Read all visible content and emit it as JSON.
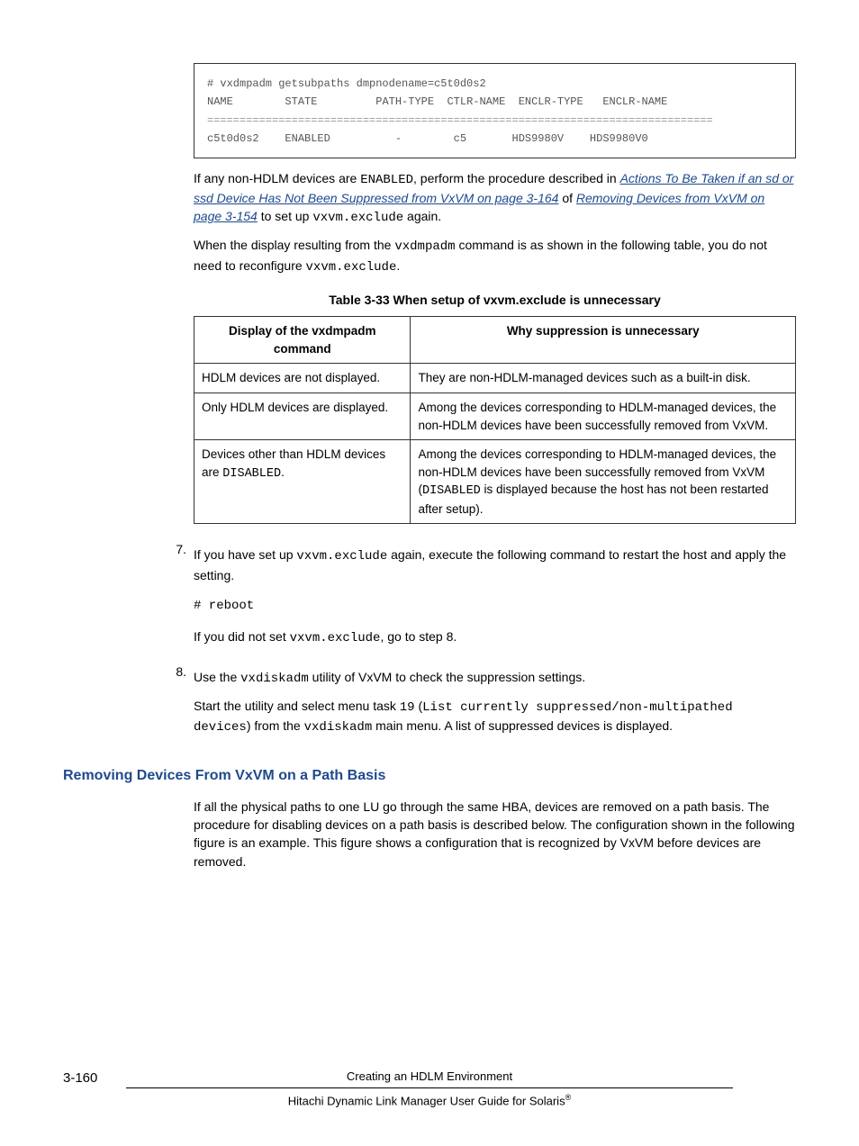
{
  "terminal": {
    "cmd": "# vxdmpadm getsubpaths dmpnodename=c5t0d0s2",
    "hdr_name": "NAME",
    "hdr_state": "STATE",
    "hdr_pathtype": "PATH-TYPE",
    "hdr_ctlr": "CTLR-NAME",
    "hdr_encltype": "ENCLR-TYPE",
    "hdr_enclname": "ENCLR-NAME",
    "row_name": "c5t0d0s2",
    "row_state": "ENABLED",
    "row_pathtype": "-",
    "row_ctlr": "c5",
    "row_encltype": "HDS9980V",
    "row_enclname": "HDS9980V0"
  },
  "para1": {
    "pre": "If any non-HDLM devices are ",
    "enabled": "ENABLED",
    "mid1": ", perform the procedure described in ",
    "link1": "Actions To Be Taken if an sd or ssd Device Has Not Been Suppressed from VxVM on page 3-164",
    "mid2": " of ",
    "link2": "Removing Devices from VxVM on page 3-154",
    "mid3": " to set up ",
    "code1": "vxvm.exclude",
    "post": " again."
  },
  "para2": {
    "pre": "When the display resulting from the ",
    "code1": "vxdmpadm",
    "mid": " command is as shown in the following table, you do not need to reconfigure ",
    "code2": "vxvm.exclude",
    "post": "."
  },
  "table_caption": "Table 3-33 When setup of vxvm.exclude is unnecessary",
  "table": {
    "h1": "Display of the vxdmpadm command",
    "h2": "Why suppression is unnecessary",
    "r1c1": "HDLM devices are not displayed.",
    "r1c2": "They are non-HDLM-managed devices such as a built-in disk.",
    "r2c1": "Only HDLM devices are displayed.",
    "r2c2": "Among the devices corresponding to HDLM-managed devices, the non-HDLM devices have been successfully removed from VxVM.",
    "r3c1_a": "Devices other than HDLM devices are ",
    "r3c1_b": "DISABLED",
    "r3c1_c": ".",
    "r3c2_a": "Among the devices corresponding to HDLM-managed devices, the non-HDLM devices have been successfully removed from VxVM (",
    "r3c2_b": "DISABLED",
    "r3c2_c": " is displayed because the host has not been restarted after setup)."
  },
  "step7": {
    "num": "7.",
    "p1a": "If you have set up ",
    "p1b": "vxvm.exclude",
    "p1c": " again, execute the following command to restart the host and apply the setting.",
    "cmd": "# reboot",
    "p2a": "If you did not set ",
    "p2b": "vxvm.exclude",
    "p2c": ", go to step 8."
  },
  "step8": {
    "num": "8.",
    "p1a": "Use the ",
    "p1b": "vxdiskadm",
    "p1c": " utility of VxVM to check the suppression settings.",
    "p2a": "Start the utility and select menu task ",
    "p2b": "19",
    "p2c": " (",
    "p2d": "List currently suppressed/non-multipathed devices",
    "p2e": ") from the ",
    "p2f": "vxdiskadm",
    "p2g": " main menu. A list of suppressed devices is displayed."
  },
  "section_heading": "Removing Devices From VxVM on a Path Basis",
  "section_body": "If all the physical paths to one LU go through the same HBA, devices are removed on a path basis. The procedure for disabling devices on a path basis is described below. The configuration shown in the following figure is an example. This figure shows a configuration that is recognized by VxVM before devices are removed.",
  "footer": {
    "pagenum": "3-160",
    "line1": "Creating an HDLM Environment",
    "line2a": "Hitachi Dynamic Link Manager User Guide for Solaris",
    "line2b": "®"
  }
}
